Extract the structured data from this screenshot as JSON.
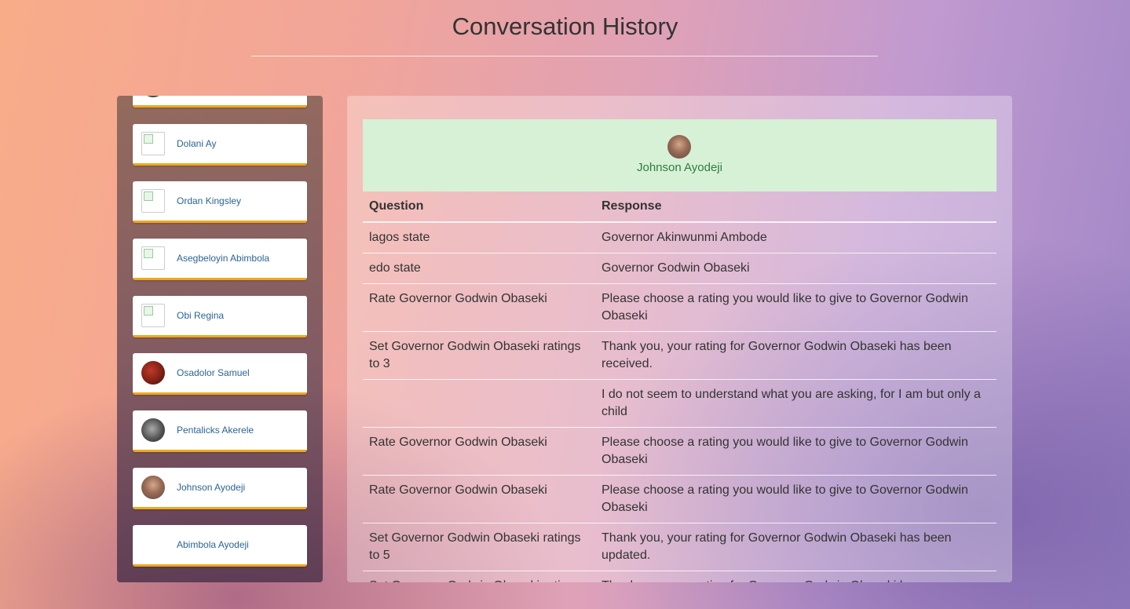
{
  "page": {
    "title": "Conversation History"
  },
  "sidebar": {
    "items": [
      {
        "name": "",
        "avatar": "gray"
      },
      {
        "name": "Dolani Ay",
        "avatar": "broken"
      },
      {
        "name": "Ordan Kingsley",
        "avatar": "broken"
      },
      {
        "name": "Asegbeloyin Abimbola",
        "avatar": "broken"
      },
      {
        "name": "Obi Regina",
        "avatar": "broken"
      },
      {
        "name": "Osadolor Samuel",
        "avatar": "red"
      },
      {
        "name": "Pentalicks Akerele",
        "avatar": "gray"
      },
      {
        "name": "Johnson Ayodeji",
        "avatar": "face"
      },
      {
        "name": "Abimbola Ayodeji",
        "avatar": "none"
      }
    ]
  },
  "conversation": {
    "user_name": "Johnson Ayodeji",
    "headers": {
      "question": "Question",
      "response": "Response"
    },
    "rows": [
      {
        "question": "lagos state",
        "response": "Governor Akinwunmi Ambode"
      },
      {
        "question": "edo state",
        "response": "Governor Godwin Obaseki"
      },
      {
        "question": "Rate Governor Godwin Obaseki",
        "response": "Please choose a rating you would like to give to Governor Godwin Obaseki"
      },
      {
        "question": "Set Governor Godwin Obaseki ratings to 3",
        "response": "Thank you, your rating for Governor Godwin Obaseki has been received."
      },
      {
        "question": "",
        "response": "I do not seem to understand what you are asking, for I am but only a child"
      },
      {
        "question": "Rate Governor Godwin Obaseki",
        "response": "Please choose a rating you would like to give to Governor Godwin Obaseki"
      },
      {
        "question": "Rate Governor Godwin Obaseki",
        "response": "Please choose a rating you would like to give to Governor Godwin Obaseki"
      },
      {
        "question": "Set Governor Godwin Obaseki ratings to 5",
        "response": "Thank you, your rating for Governor Godwin Obaseki has been updated."
      },
      {
        "question": "Set Governor Godwin Obaseki ratings",
        "response": "Thank you, your rating for Governor Godwin Obaseki has"
      }
    ]
  }
}
